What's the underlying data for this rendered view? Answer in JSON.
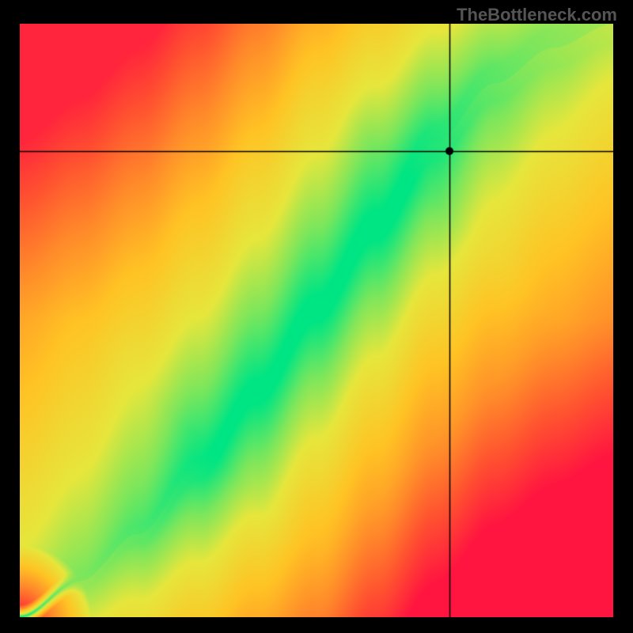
{
  "watermark": "TheBottleneck.com",
  "chart_data": {
    "type": "heatmap",
    "title": "",
    "xlabel": "",
    "ylabel": "",
    "xlim": [
      0,
      1
    ],
    "ylim": [
      0,
      1
    ],
    "crosshair": {
      "x": 0.725,
      "y": 0.785
    },
    "marker": {
      "x": 0.725,
      "y": 0.785
    },
    "ridge_curve": {
      "description": "green optimal band along a curve from bottom-left to top-right",
      "points": [
        {
          "x": 0.0,
          "y": 0.0
        },
        {
          "x": 0.1,
          "y": 0.06
        },
        {
          "x": 0.2,
          "y": 0.14
        },
        {
          "x": 0.3,
          "y": 0.25
        },
        {
          "x": 0.4,
          "y": 0.38
        },
        {
          "x": 0.5,
          "y": 0.52
        },
        {
          "x": 0.6,
          "y": 0.66
        },
        {
          "x": 0.7,
          "y": 0.8
        },
        {
          "x": 0.8,
          "y": 0.9
        },
        {
          "x": 0.9,
          "y": 0.96
        },
        {
          "x": 1.0,
          "y": 1.0
        }
      ],
      "band_half_width": 0.035
    },
    "colorscale": [
      {
        "t": 0.0,
        "color": "#00e583"
      },
      {
        "t": 0.12,
        "color": "#7CE65C"
      },
      {
        "t": 0.25,
        "color": "#E6E63C"
      },
      {
        "t": 0.45,
        "color": "#FFC324"
      },
      {
        "t": 0.65,
        "color": "#FF8A2A"
      },
      {
        "t": 0.82,
        "color": "#FF5030"
      },
      {
        "t": 1.0,
        "color": "#FF1540"
      }
    ]
  }
}
